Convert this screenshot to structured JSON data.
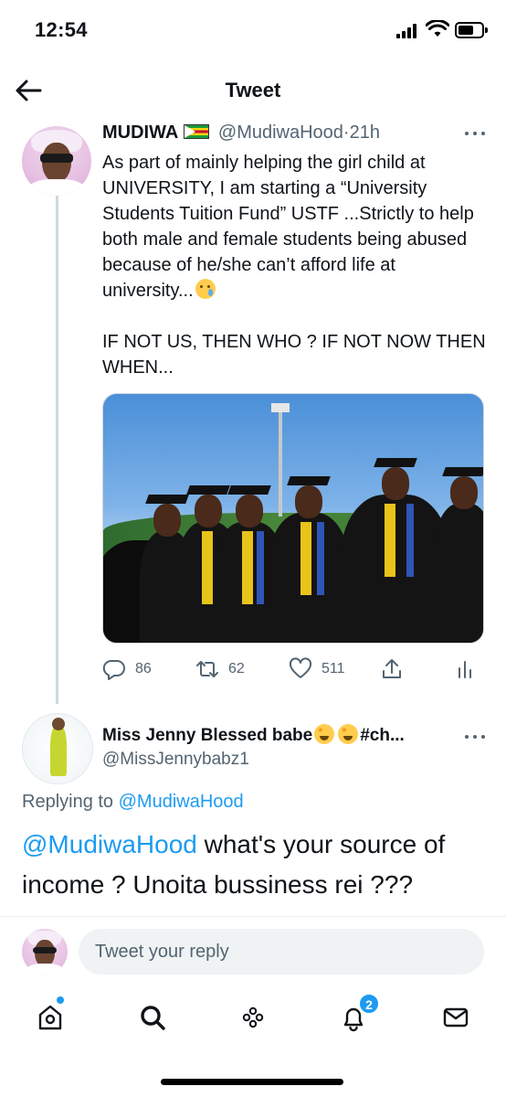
{
  "status_bar": {
    "time": "12:54"
  },
  "header": {
    "title": "Tweet"
  },
  "tweet": {
    "author_name": "MUDIWA",
    "author_handle": "@MudiwaHood",
    "separator": "·",
    "timestamp": "21h",
    "text_lines": [
      "As part of mainly helping the girl child at UNIVERSITY, I am starting a “University Students Tuition Fund” USTF ...Strictly to help both male and female students being abused because of he/she can’t afford life at university...",
      "IF NOT US, THEN WHO ? IF NOT NOW THEN WHEN..."
    ],
    "emoji": "crying-face",
    "stats": {
      "replies": "86",
      "retweets": "62",
      "likes": "511"
    }
  },
  "reply": {
    "author_name": "Miss Jenny Blessed babe",
    "author_name_suffix": "#ch...",
    "author_handle": "@MissJennybabz1",
    "replying_to_prefix": "Replying to",
    "replying_to_handle": "@MudiwaHood",
    "mention": "@MudiwaHood",
    "text": " what's your source of income ? Unoita bussiness rei ???"
  },
  "compose": {
    "placeholder": "Tweet your reply"
  },
  "tabbar": {
    "notifications_count": "2"
  },
  "colors": {
    "accent": "#1d9bf0",
    "muted": "#536471",
    "text": "#0f1419"
  }
}
